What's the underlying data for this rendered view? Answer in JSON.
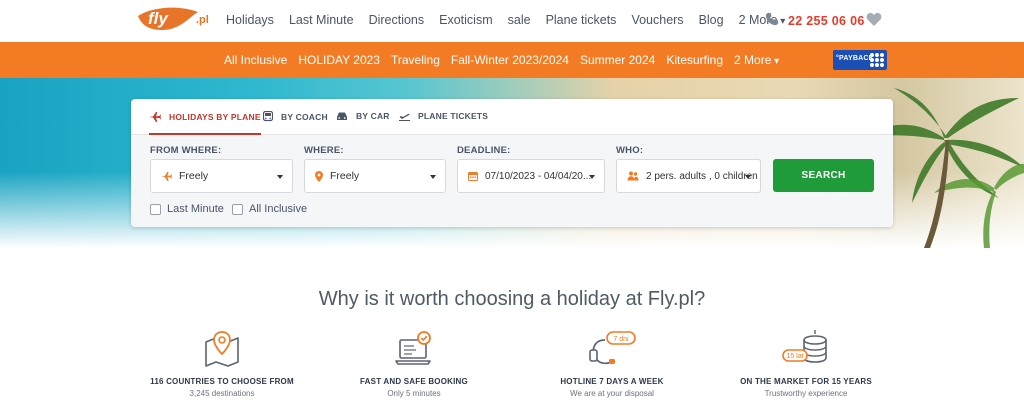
{
  "header": {
    "logo_text": "fly",
    "logo_suffix": ".pl",
    "nav": [
      "Holidays",
      "Last Minute",
      "Directions",
      "Exoticism",
      "sale",
      "Plane tickets",
      "Vouchers",
      "Blog",
      "2 More"
    ],
    "phone": "22 255 06 06",
    "icons": [
      "phone-icon",
      "heart-icon"
    ]
  },
  "subnav": {
    "items": [
      "All Inclusive",
      "HOLIDAY 2023",
      "Traveling",
      "Fall-Winter 2023/2024",
      "Summer 2024",
      "Kitesurfing",
      "2 More"
    ],
    "payback_label": "°PAYBACK"
  },
  "search": {
    "tabs": [
      {
        "label": "HOLIDAYS BY PLANE",
        "icon": "plane-icon"
      },
      {
        "label": "BY COACH",
        "icon": "bus-icon"
      },
      {
        "label": "BY CAR",
        "icon": "car-icon"
      },
      {
        "label": "PLANE TICKETS",
        "icon": "plane-takeoff-icon"
      }
    ],
    "from": {
      "label": "FROM WHERE:",
      "value": "Freely"
    },
    "to": {
      "label": "WHERE:",
      "value": "Freely"
    },
    "deadline": {
      "label": "DEADLINE:",
      "value": "07/10/2023 - 04/04/20..."
    },
    "who": {
      "label": "WHO:",
      "value": "2 pers. adults , 0 children"
    },
    "button": "SEARCH",
    "checkboxes": [
      "Last Minute",
      "All Inclusive"
    ]
  },
  "why": {
    "title": "Why is it worth choosing a holiday at Fly.pl?",
    "features": [
      {
        "title": "116 COUNTRIES TO CHOOSE FROM",
        "subtitle": "3,245 destinations",
        "icon": "map-pin-icon"
      },
      {
        "title": "FAST AND SAFE BOOKING",
        "subtitle": "Only 5 minutes",
        "icon": "laptop-check-icon",
        "badge": ""
      },
      {
        "title": "HOTLINE 7 DAYS A WEEK",
        "subtitle": "We are at your disposal",
        "icon": "headset-icon",
        "badge": "7 dni"
      },
      {
        "title": "ON THE MARKET FOR 15 YEARS",
        "subtitle": "Trustworthy experience",
        "icon": "coins-icon",
        "badge": "15 lat"
      }
    ]
  },
  "colors": {
    "brand_orange": "#f37b24",
    "search_green": "#1f9b3a",
    "accent_red": "#c0392b",
    "phone_red": "#e63b2a"
  }
}
